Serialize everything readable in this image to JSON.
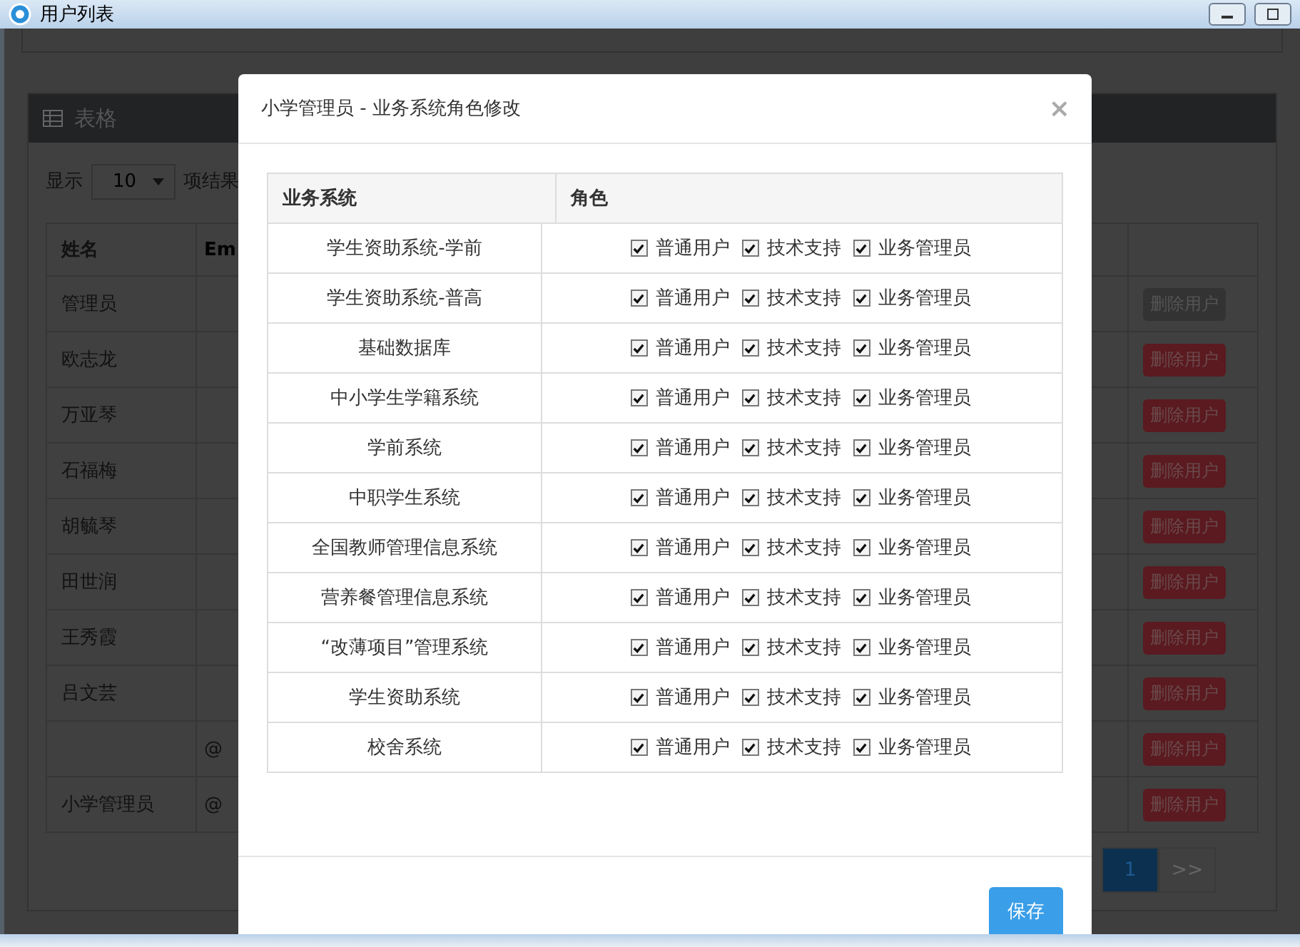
{
  "window": {
    "title": "用户列表"
  },
  "page": {
    "panel_title": "表格",
    "length_label": "显示",
    "length_value": "10",
    "info_label": "项结果",
    "columns": [
      "姓名",
      "Em"
    ],
    "rows": [
      {
        "name": "管理员",
        "email": "",
        "delete": {
          "label": "删除用户",
          "disabled": true
        }
      },
      {
        "name": "欧志龙",
        "email": "",
        "delete": {
          "label": "删除用户",
          "disabled": false
        }
      },
      {
        "name": "万亚琴",
        "email": "",
        "delete": {
          "label": "删除用户",
          "disabled": false
        }
      },
      {
        "name": "石福梅",
        "email": "",
        "delete": {
          "label": "删除用户",
          "disabled": false
        }
      },
      {
        "name": "胡毓琴",
        "email": "",
        "delete": {
          "label": "删除用户",
          "disabled": false
        }
      },
      {
        "name": "田世润",
        "email": "",
        "delete": {
          "label": "删除用户",
          "disabled": false
        }
      },
      {
        "name": "王秀霞",
        "email": "",
        "delete": {
          "label": "删除用户",
          "disabled": false
        }
      },
      {
        "name": "吕文芸",
        "email": "",
        "delete": {
          "label": "删除用户",
          "disabled": false
        }
      },
      {
        "name": "",
        "email": "@",
        "delete": {
          "label": "删除用户",
          "disabled": false
        }
      },
      {
        "name": "小学管理员",
        "email": "@",
        "delete": {
          "label": "删除用户",
          "disabled": false
        }
      }
    ],
    "pagination": [
      {
        "label": "1",
        "selected": true
      },
      {
        "label": ">>",
        "selected": false
      }
    ]
  },
  "modal": {
    "title": "小学管理员 - 业务系统角色修改",
    "close": "×",
    "columns": [
      "业务系统",
      "角色"
    ],
    "rows": [
      {
        "system": "学生资助系统-学前",
        "roles": [
          {
            "label": "普通用户",
            "checked": true
          },
          {
            "label": "技术支持",
            "checked": true
          },
          {
            "label": "业务管理员",
            "checked": true
          }
        ]
      },
      {
        "system": "学生资助系统-普高",
        "roles": [
          {
            "label": "普通用户",
            "checked": true
          },
          {
            "label": "技术支持",
            "checked": true
          },
          {
            "label": "业务管理员",
            "checked": true
          }
        ]
      },
      {
        "system": "基础数据库",
        "roles": [
          {
            "label": "普通用户",
            "checked": true
          },
          {
            "label": "技术支持",
            "checked": true
          },
          {
            "label": "业务管理员",
            "checked": true
          }
        ]
      },
      {
        "system": "中小学生学籍系统",
        "roles": [
          {
            "label": "普通用户",
            "checked": true
          },
          {
            "label": "技术支持",
            "checked": true
          },
          {
            "label": "业务管理员",
            "checked": true
          }
        ]
      },
      {
        "system": "学前系统",
        "roles": [
          {
            "label": "普通用户",
            "checked": true
          },
          {
            "label": "技术支持",
            "checked": true
          },
          {
            "label": "业务管理员",
            "checked": true
          }
        ]
      },
      {
        "system": "中职学生系统",
        "roles": [
          {
            "label": "普通用户",
            "checked": true
          },
          {
            "label": "技术支持",
            "checked": true
          },
          {
            "label": "业务管理员",
            "checked": true
          }
        ]
      },
      {
        "system": "全国教师管理信息系统",
        "roles": [
          {
            "label": "普通用户",
            "checked": true
          },
          {
            "label": "技术支持",
            "checked": true
          },
          {
            "label": "业务管理员",
            "checked": true
          }
        ]
      },
      {
        "system": "营养餐管理信息系统",
        "roles": [
          {
            "label": "普通用户",
            "checked": true
          },
          {
            "label": "技术支持",
            "checked": true
          },
          {
            "label": "业务管理员",
            "checked": true
          }
        ]
      },
      {
        "system": "“改薄项目”管理系统",
        "roles": [
          {
            "label": "普通用户",
            "checked": true
          },
          {
            "label": "技术支持",
            "checked": true
          },
          {
            "label": "业务管理员",
            "checked": true
          }
        ]
      },
      {
        "system": "学生资助系统",
        "roles": [
          {
            "label": "普通用户",
            "checked": true
          },
          {
            "label": "技术支持",
            "checked": true
          },
          {
            "label": "业务管理员",
            "checked": true
          }
        ]
      },
      {
        "system": "校舍系统",
        "roles": [
          {
            "label": "普通用户",
            "checked": true
          },
          {
            "label": "技术支持",
            "checked": true
          },
          {
            "label": "业务管理员",
            "checked": true
          }
        ]
      }
    ],
    "save": "保存"
  }
}
